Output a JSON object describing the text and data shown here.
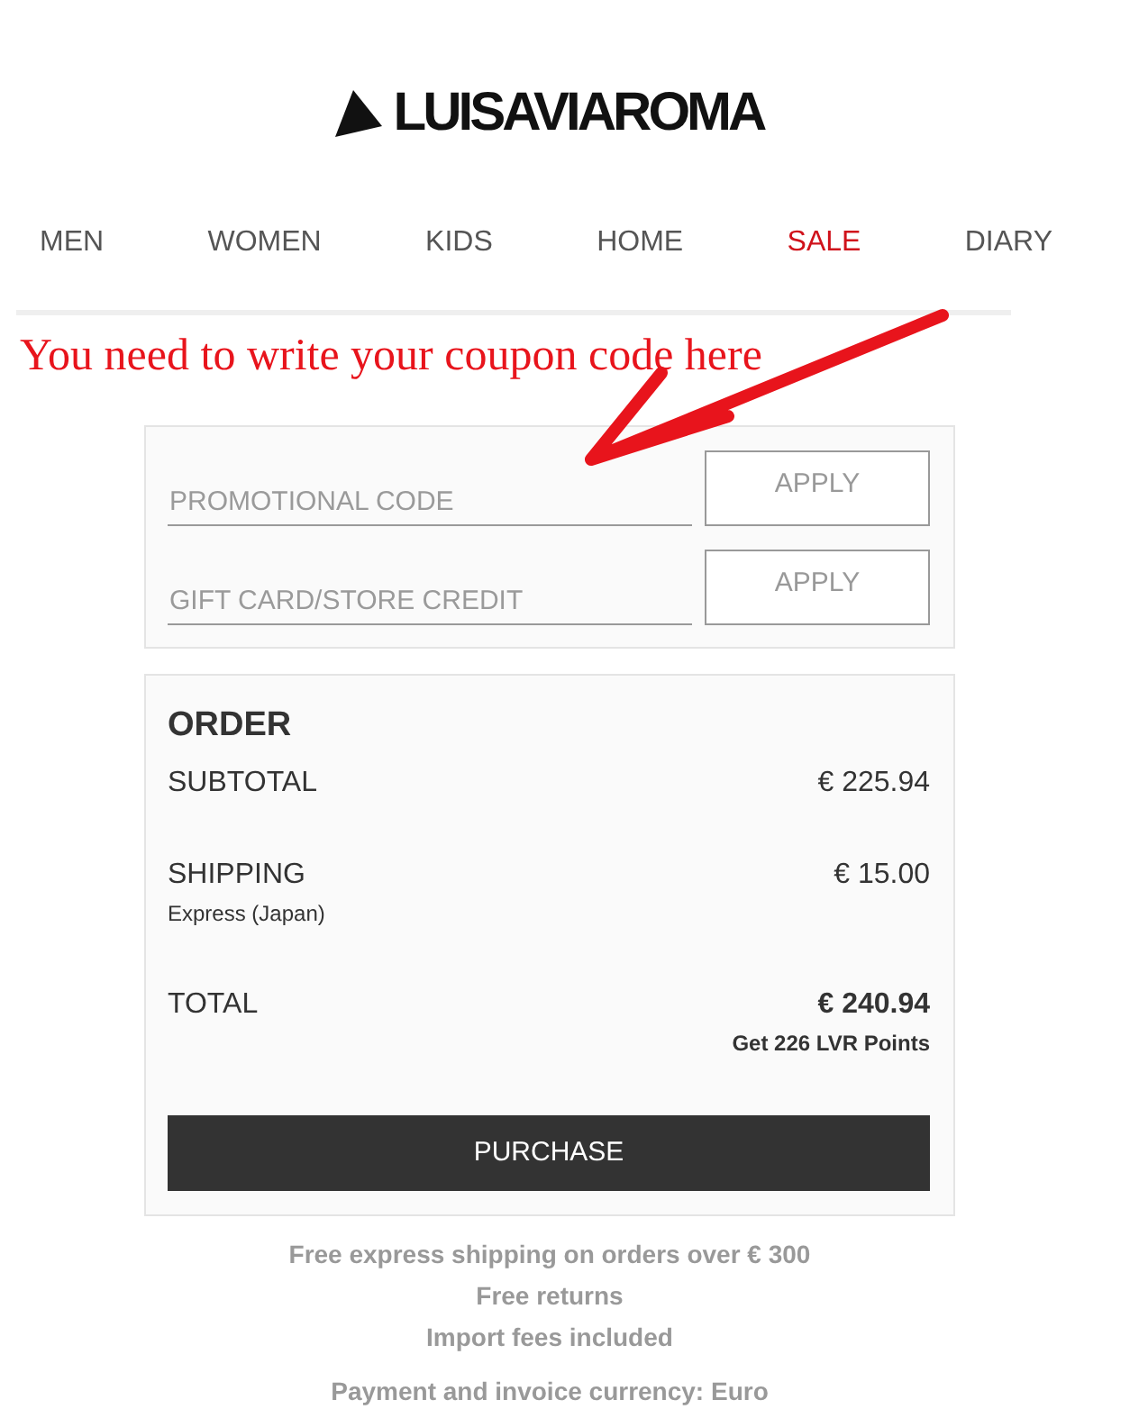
{
  "logo": {
    "text": "LUISAVIAROMA"
  },
  "nav": [
    {
      "label": "MEN",
      "color": "#555555"
    },
    {
      "label": "WOMEN",
      "color": "#555555"
    },
    {
      "label": "KIDS",
      "color": "#555555"
    },
    {
      "label": "HOME",
      "color": "#555555"
    },
    {
      "label": "SALE",
      "color": "#d0121b"
    },
    {
      "label": "DIARY",
      "color": "#555555"
    }
  ],
  "annotation": {
    "text": "You need to write your coupon code here"
  },
  "coupon_form": {
    "fields": [
      {
        "placeholder": "PROMOTIONAL CODE",
        "button": "APPLY"
      },
      {
        "placeholder": "GIFT CARD/STORE CREDIT",
        "button": "APPLY"
      }
    ]
  },
  "order": {
    "title": "ORDER",
    "lines": [
      {
        "kind": "line",
        "label": "SUBTOTAL",
        "amount": "€ 225.94"
      },
      {
        "kind": "line",
        "label": "SHIPPING",
        "note": "Express (Japan)",
        "amount": "€ 15.00"
      },
      {
        "kind": "total",
        "label": "TOTAL",
        "amount": "€ 240.94",
        "note": "Get 226 LVR Points"
      }
    ],
    "button": "PURCHASE"
  },
  "footer": {
    "perks": [
      "Free express shipping on orders over € 300",
      "Free returns",
      "Import fees included"
    ],
    "currency_note": "Payment and invoice currency: Euro"
  }
}
